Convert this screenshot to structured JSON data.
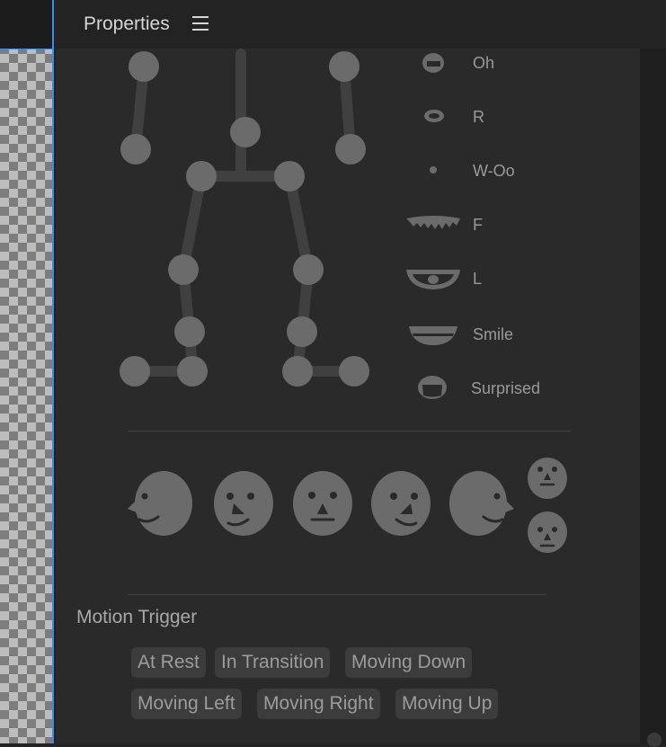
{
  "panel": {
    "title": "Properties"
  },
  "visemes": [
    {
      "label": "Oh",
      "icon": "mouth-oh-icon"
    },
    {
      "label": "R",
      "icon": "mouth-r-icon"
    },
    {
      "label": "W-Oo",
      "icon": "mouth-w-oo-icon"
    },
    {
      "label": "F",
      "icon": "mouth-f-icon"
    },
    {
      "label": "L",
      "icon": "mouth-l-icon"
    },
    {
      "label": "Smile",
      "icon": "mouth-smile-icon"
    },
    {
      "label": "Surprised",
      "icon": "mouth-surprised-icon"
    }
  ],
  "views": [
    "left-profile",
    "left-quarter",
    "frontal",
    "right-quarter",
    "right-profile",
    "upward",
    "downward"
  ],
  "motion_trigger": {
    "title": "Motion Trigger",
    "tags": [
      "At Rest",
      "In Transition",
      "Moving Down",
      "Moving Left",
      "Moving Right",
      "Moving Up"
    ]
  },
  "colors": {
    "accent": "#3a8ee6",
    "glyph": "#6b6b6b",
    "panel": "#2a2a2a"
  }
}
